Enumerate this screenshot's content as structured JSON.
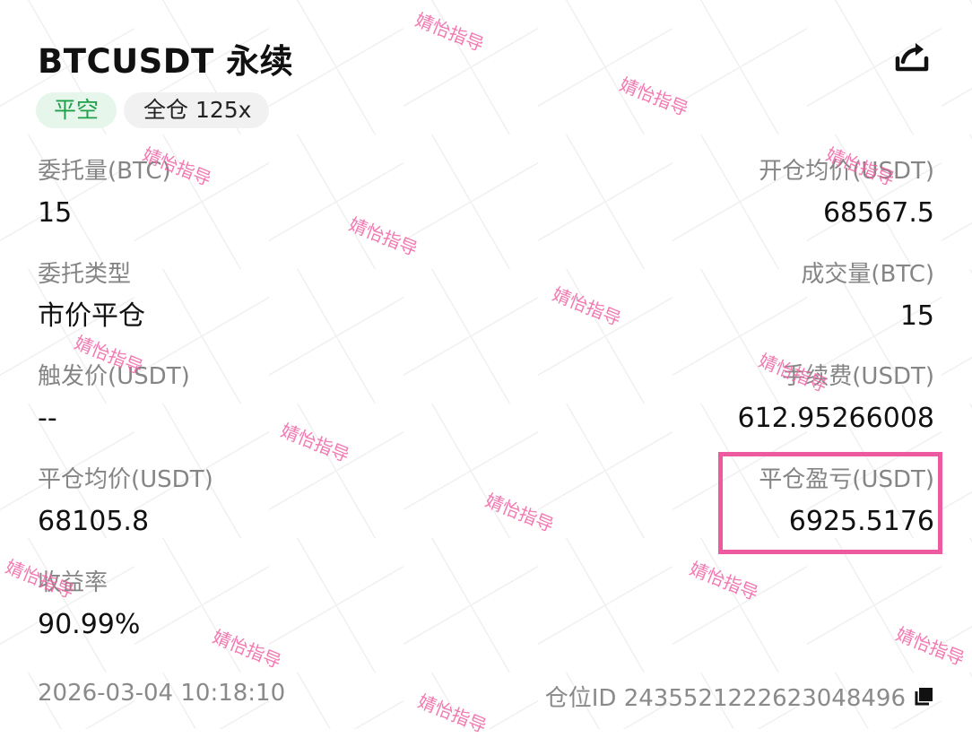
{
  "header": {
    "title": "BTCUSDT 永续"
  },
  "tags": {
    "side": "平空",
    "margin": "全仓 125x"
  },
  "fields": {
    "order_qty": {
      "label": "委托量(BTC)",
      "value": "15"
    },
    "open_avg": {
      "label": "开仓均价(USDT)",
      "value": "68567.5"
    },
    "order_type": {
      "label": "委托类型",
      "value": "市价平仓"
    },
    "filled_qty": {
      "label": "成交量(BTC)",
      "value": "15"
    },
    "trigger_price": {
      "label": "触发价(USDT)",
      "value": "--"
    },
    "fee": {
      "label": "手续费(USDT)",
      "value": "612.95266008"
    },
    "close_avg": {
      "label": "平仓均价(USDT)",
      "value": "68105.8"
    },
    "close_pnl": {
      "label": "平仓盈亏(USDT)",
      "value": "6925.5176"
    },
    "roi": {
      "label": "收益率",
      "value": "90.99%"
    }
  },
  "footer": {
    "timestamp": "2026-03-04 10:18:10",
    "position_id": "仓位ID 2435521222623048496"
  },
  "watermark": {
    "text": "婧怡指导"
  },
  "icons": {
    "share": "share-icon",
    "copy": "copy-icon"
  },
  "colors": {
    "highlight": "#ee5aa0",
    "side_tag_text": "#1fa04a",
    "side_tag_bg": "#e6f6ea",
    "watermark": "#f062a4"
  }
}
